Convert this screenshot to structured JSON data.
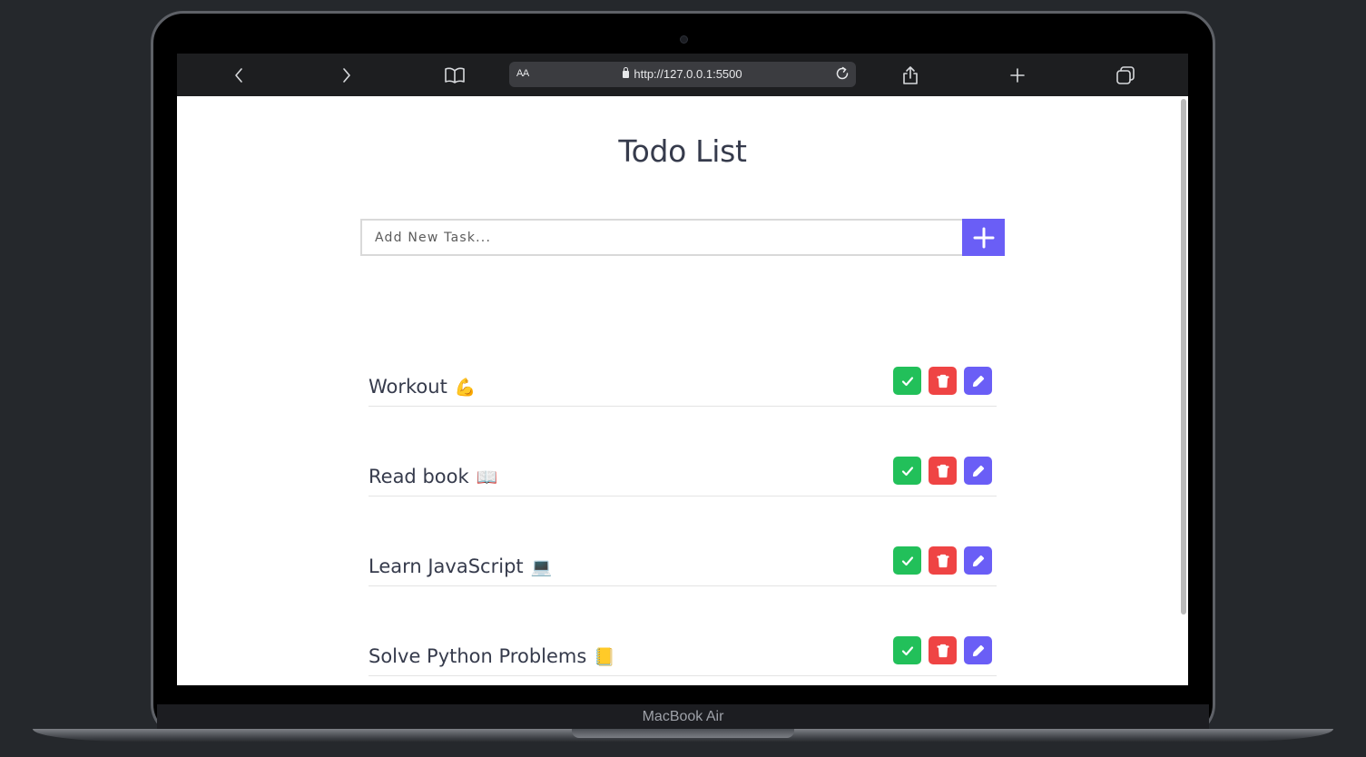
{
  "device": {
    "label": "MacBook Air"
  },
  "browser": {
    "text_size_label": "AA",
    "url": "http://127.0.0.1:5500"
  },
  "page": {
    "title": "Todo List",
    "input_placeholder": "Add New Task..."
  },
  "tasks": [
    {
      "name": "Workout",
      "emoji": "💪"
    },
    {
      "name": "Read book",
      "emoji": "📖"
    },
    {
      "name": "Learn JavaScript",
      "emoji": "💻"
    },
    {
      "name": "Solve Python Problems",
      "emoji": "📒"
    }
  ],
  "icons": {
    "toolbar": [
      "back-icon",
      "forward-icon",
      "book-icon",
      "share-icon",
      "new-tab-icon",
      "tabs-icon"
    ],
    "task_actions": [
      "check-icon",
      "trash-icon",
      "pencil-icon"
    ]
  },
  "colors": {
    "accent": "#6a5ef6",
    "done": "#22c05a",
    "delete": "#ef4444",
    "text": "#363b4c"
  }
}
